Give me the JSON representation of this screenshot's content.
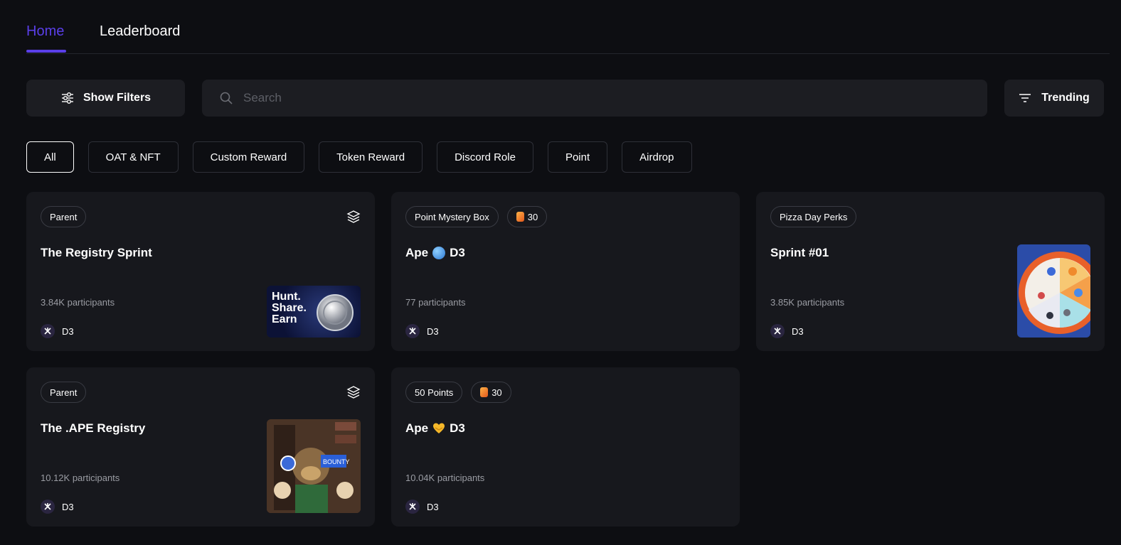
{
  "tabs": {
    "home": "Home",
    "leaderboard": "Leaderboard"
  },
  "toolbar": {
    "filters_label": "Show Filters",
    "search_placeholder": "Search",
    "sort_label": "Trending"
  },
  "chips": [
    "All",
    "OAT & NFT",
    "Custom Reward",
    "Token Reward",
    "Discord Role",
    "Point",
    "Airdrop"
  ],
  "cards": [
    {
      "tags": [
        "Parent"
      ],
      "title": "The Registry Sprint",
      "participants": "3.84K participants",
      "owner": "D3",
      "thumb_text": [
        "Hunt.",
        "Share.",
        "Earn"
      ]
    },
    {
      "tags": [
        "Point Mystery Box",
        "30"
      ],
      "title_a": "Ape",
      "title_b": "D3",
      "participants": "77 participants",
      "owner": "D3"
    },
    {
      "tags": [
        "Pizza Day Perks"
      ],
      "title": "Sprint #01",
      "participants": "3.85K participants",
      "owner": "D3"
    },
    {
      "tags": [
        "Parent"
      ],
      "title": "The .APE Registry",
      "participants": "10.12K participants",
      "owner": "D3",
      "thumb_text": [
        "BOUNTY"
      ]
    },
    {
      "tags": [
        "50 Points",
        "30"
      ],
      "title_a": "Ape",
      "title_b": "D3",
      "participants": "10.04K participants",
      "owner": "D3"
    }
  ],
  "colors": {
    "accent": "#5a3fe8",
    "background": "#0d0e12",
    "card": "#17181d"
  }
}
